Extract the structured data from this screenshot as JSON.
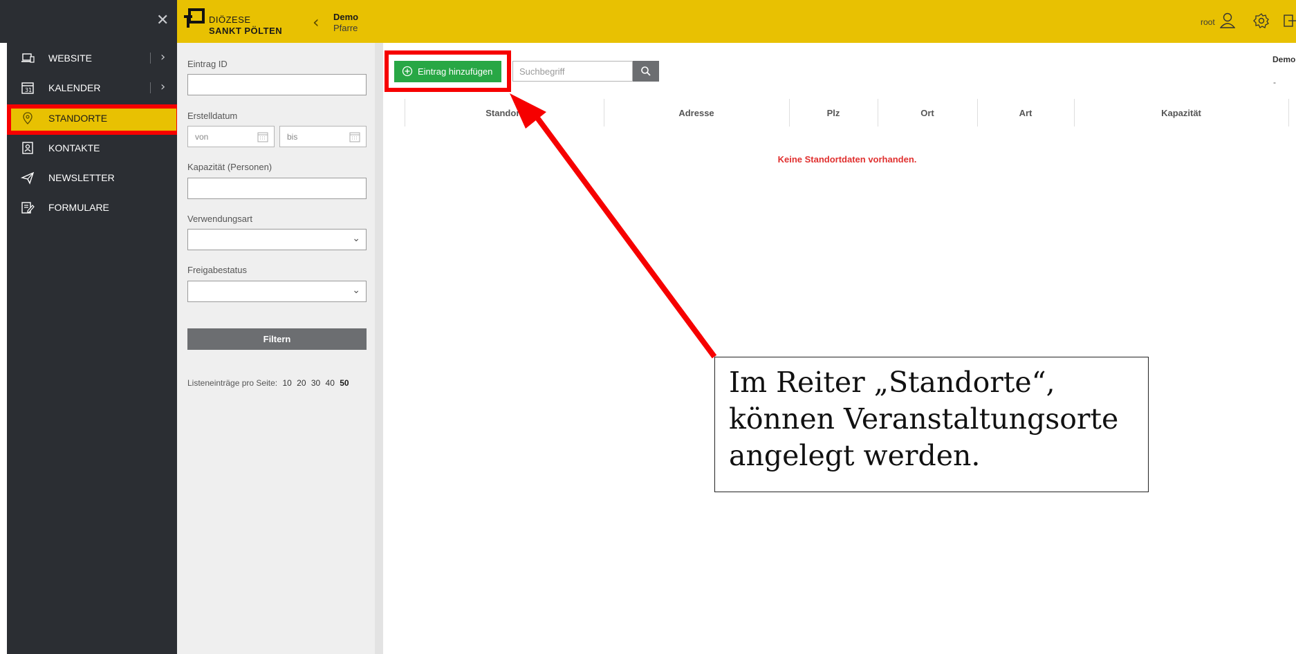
{
  "header": {
    "logo_line1": "DIÖZESE",
    "logo_line2": "SANKT PÖLTEN",
    "context_title": "Demo",
    "context_subtitle": "Pfarre",
    "user": "root",
    "accent_color": "#e8c102"
  },
  "sidebar": {
    "items": [
      {
        "label": "WEBSITE",
        "icon": "laptop-icon"
      },
      {
        "label": "KALENDER",
        "icon": "calendar-icon"
      },
      {
        "label": "STANDORTE",
        "icon": "location-pin-icon",
        "active": true
      },
      {
        "label": "KONTAKTE",
        "icon": "contact-book-icon"
      },
      {
        "label": "NEWSLETTER",
        "icon": "paper-plane-icon"
      },
      {
        "label": "FORMULARE",
        "icon": "form-edit-icon"
      }
    ]
  },
  "filter": {
    "entry_id_label": "Eintrag ID",
    "created_label": "Erstelldatum",
    "from_placeholder": "von",
    "to_placeholder": "bis",
    "capacity_label": "Kapazität (Personen)",
    "usage_label": "Verwendungsart",
    "release_label": "Freigabestatus",
    "filter_button": "Filtern",
    "per_page_label": "Listeneinträge pro Seite:",
    "per_page_options": [
      "10",
      "20",
      "30",
      "40",
      "50"
    ],
    "per_page_selected": "50"
  },
  "main": {
    "add_button": "Eintrag hinzufügen",
    "search_placeholder": "Suchbegriff",
    "corner_title": "Demo",
    "corner_dash": "-",
    "columns": [
      "Standort",
      "Adresse",
      "Plz",
      "Ort",
      "Art",
      "Kapazität"
    ],
    "empty_message": "Keine Standortdaten vorhanden."
  },
  "annotation": {
    "text": "Im Reiter „Standorte“, können Veranstaltungsorte angelegt werden.",
    "highlight_color": "#f60000"
  }
}
